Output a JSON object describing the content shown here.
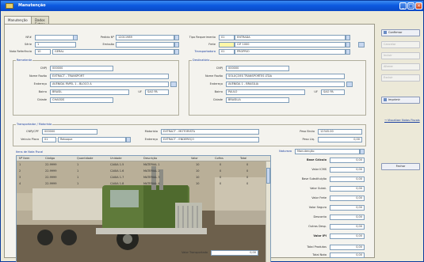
{
  "window": {
    "title": "Manutenção",
    "buttons": [
      "_",
      "□",
      "×"
    ]
  },
  "tabs": [
    {
      "label": "Manutenção",
      "active": true
    },
    {
      "label": "Dados Extras",
      "active": false
    }
  ],
  "header": {
    "nf_label": "NF#",
    "nf_value": "",
    "serie_label": "Série",
    "serie_value": "1",
    "nota_label": "Nota Referência",
    "nota_value": "10",
    "nota_name": "GERAL",
    "pedido_label": "Pedido Nº",
    "pedido_value": "12011989",
    "emissao_label": "Emissão",
    "emissao_value": "",
    "tipo_label": "Tipo Requerimento",
    "tipo_value": "01",
    "tipo_name": "ENTRADA",
    "frete_label": "Frete",
    "frete_value": "",
    "frete_name": "CIF 1000",
    "transp_label": "Transportadora",
    "transp_value": "01",
    "transp_name": "PRÓPRIO"
  },
  "remetente": {
    "title": "Remetente",
    "cnpj_label": "CNPJ",
    "cnpj_value": "000000",
    "nome_label": "Nome Razão",
    "nome_value": "EXTRACT - TRANSPORT",
    "endereco_label": "Endereço",
    "endereco_value": "AVENIDA PAPEL 1 - BLOCO A",
    "bairro_label": "Bairro",
    "bairro_value": "BRASIL",
    "uf_label": "UF",
    "uf_value": "SÃO PA",
    "cidade_label": "Cidade",
    "cidade_value": "CHASSIS"
  },
  "destinatario": {
    "title": "Destinatário",
    "cnpj_label": "CNPJ",
    "cnpj_value": "000000",
    "nome_label": "Nome Razão",
    "nome_value": "SOLUÇÕES TRANSPORTES LTDA",
    "endereco_label": "Endereço",
    "endereco_value": "AVENIDA 1 - BRASÍLIA",
    "bairro_label": "Bairro",
    "bairro_value": "PAULO",
    "uf_label": "UF",
    "uf_value": "SÃO PA",
    "cidade_label": "Cidade",
    "cidade_value": "BRASÍLIA"
  },
  "transportador": {
    "title": "Transportador / Motorista",
    "cnpj_label": "CNPJ/CPF",
    "cnpj_value": "000000",
    "placa_label": "Veículo Placa",
    "placa_value": "01",
    "placa_name": "Reboque",
    "motorista_label": "Motorista",
    "motorista_value": "EXTRACT - MOTORISTA",
    "endereco_label": "Endereço",
    "endereco_value": "EXTRACT - ENDEREÇO",
    "pesob_label": "Peso Bruto",
    "pesob_value": "12345.00",
    "pesol_label": "Peso Líq.",
    "pesol_value": "0,00"
  },
  "items": {
    "title": "Itens de Nota Fiscal",
    "columns": [
      "Nº Item",
      "Código",
      "Quantidade",
      "Unidade",
      "Descrição",
      "Valor",
      "Cofins",
      "Total"
    ],
    "rows": [
      [
        "1",
        "22.9999",
        "1",
        "CAIXA 1.5",
        "MATERIAL 1",
        "10",
        "0",
        "0"
      ],
      [
        "2",
        "22.9999",
        "1",
        "CAIXA 1.6",
        "MATERIAL 2",
        "10",
        "0",
        "0"
      ],
      [
        "3",
        "22.9999",
        "1",
        "CAIXA 1.7",
        "MATERIAL 3",
        "10",
        "0",
        "0"
      ],
      [
        "4",
        "22.9999",
        "1",
        "CAIXA 1.8",
        "MATERIAL 4",
        "10",
        "0",
        "0"
      ]
    ]
  },
  "totals": {
    "natureza_label": "Natureza",
    "natureza_value": "Manutenção",
    "lines": [
      {
        "label": "Base Cálculo",
        "value": "0,00"
      },
      {
        "label": "Valor ICMS",
        "value": "0,00"
      },
      {
        "label": "Base Substituição",
        "value": "0,00"
      },
      {
        "label": "Valor Subst.",
        "value": "0,00"
      },
      {
        "label": "Valor Frete",
        "value": "0,00"
      },
      {
        "label": "Valor Seguro",
        "value": "0,00"
      },
      {
        "label": "Desconto",
        "value": "0,00"
      },
      {
        "label": "Outras Desp.",
        "value": "0,00"
      },
      {
        "label": "Valor IPI",
        "value": "0,00"
      },
      {
        "label": "Total Produtos",
        "value": "0,00"
      },
      {
        "label": "Total Nota",
        "value": "0,00"
      }
    ]
  },
  "footer": {
    "obs_label": "Valor Transportado",
    "obs_value": "0,00"
  },
  "side_buttons": [
    {
      "label": "Confirmar",
      "enabled": true
    },
    {
      "label": "Cancelar",
      "enabled": false
    },
    {
      "label": "Incluir",
      "enabled": false
    },
    {
      "label": "Alterar",
      "enabled": false
    },
    {
      "label": "Excluir",
      "enabled": false
    },
    {
      "label": "Imprimir",
      "enabled": true
    }
  ],
  "side_link": "Visualizar Notas Fiscais",
  "side_action": "Fechar"
}
